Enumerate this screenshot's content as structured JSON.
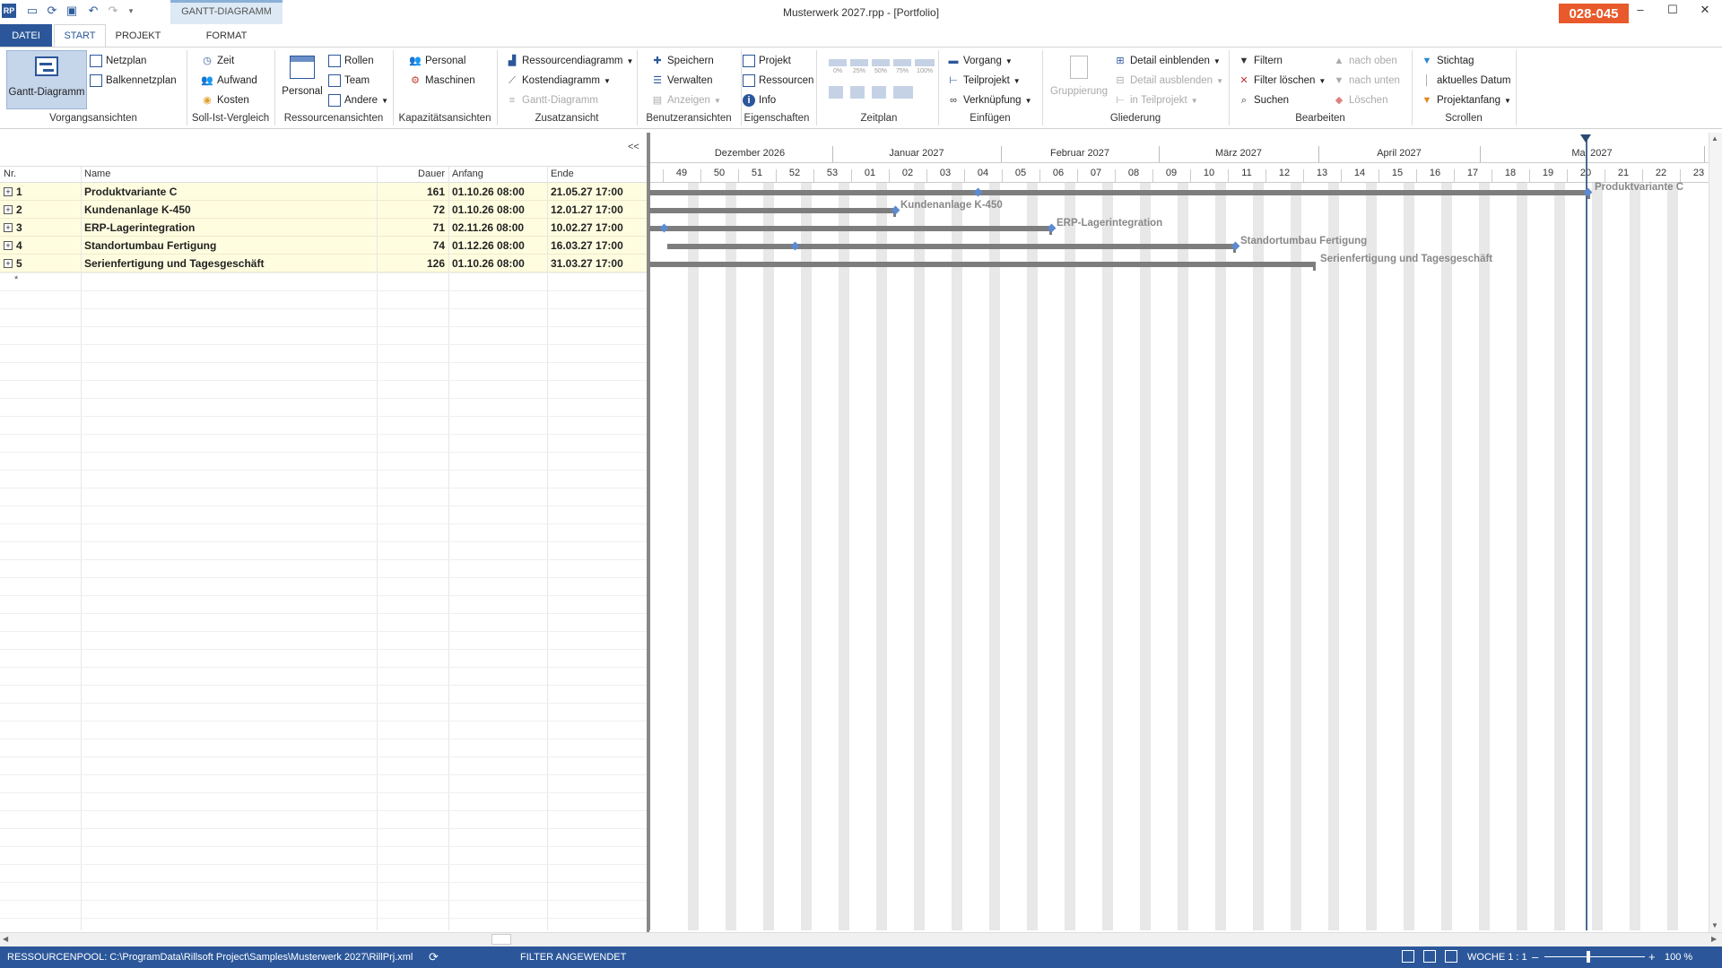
{
  "app": {
    "title": "Musterwerk 2027.rpp - [Portfolio]",
    "license": "028-045",
    "context_tab": "GANTT-DIAGRAMM"
  },
  "tabs": {
    "datei": "DATEI",
    "start": "START",
    "projekt": "PROJEKT",
    "format": "FORMAT"
  },
  "ribbon": {
    "vorgangsansichten": {
      "gantt": "Gantt-Diagramm",
      "netzplan": "Netzplan",
      "balkennetzplan": "Balkennetzplan",
      "label": "Vorgangsansichten"
    },
    "sollist": {
      "zeit": "Zeit",
      "aufwand": "Aufwand",
      "kosten": "Kosten",
      "label": "Soll-Ist-Vergleich"
    },
    "ressourcen": {
      "personal": "Personal",
      "rollen": "Rollen",
      "team": "Team",
      "andere": "Andere",
      "label": "Ressourcenansichten"
    },
    "kapazitaet": {
      "personal": "Personal",
      "maschinen": "Maschinen",
      "label": "Kapazitätsansichten"
    },
    "zusatz": {
      "ressourcendiagramm": "Ressourcendiagramm",
      "kostendiagramm": "Kostendiagramm",
      "gantt": "Gantt-Diagramm",
      "label": "Zusatzansicht"
    },
    "benutzer": {
      "speichern": "Speichern",
      "verwalten": "Verwalten",
      "anzeigen": "Anzeigen",
      "label": "Benutzeransichten"
    },
    "eigenschaften": {
      "projekt": "Projekt",
      "ressourcen": "Ressourcen",
      "info": "Info",
      "label": "Eigenschaften"
    },
    "zeitplan": {
      "label": "Zeitplan",
      "p0": "0%",
      "p25": "25%",
      "p50": "50%",
      "p75": "75%",
      "p100": "100%"
    },
    "einfuegen": {
      "vorgang": "Vorgang",
      "teilprojekt": "Teilprojekt",
      "verknuepfung": "Verknüpfung",
      "label": "Einfügen"
    },
    "gliederung": {
      "gruppierung": "Gruppierung",
      "einblenden": "Detail einblenden",
      "ausblenden": "Detail ausblenden",
      "teilprojekt": "in Teilprojekt",
      "label": "Gliederung"
    },
    "bearbeiten": {
      "filtern": "Filtern",
      "filterloeschen": "Filter löschen",
      "suchen": "Suchen",
      "nachoben": "nach oben",
      "nachunten": "nach unten",
      "loeschen": "Löschen",
      "label": "Bearbeiten"
    },
    "scrollen": {
      "stichtag": "Stichtag",
      "datum": "aktuelles Datum",
      "projektanfang": "Projektanfang",
      "label": "Scrollen"
    }
  },
  "table": {
    "collapse": "<<",
    "headers": {
      "nr": "Nr.",
      "name": "Name",
      "dauer": "Dauer",
      "anfang": "Anfang",
      "ende": "Ende"
    },
    "new_row_marker": "*",
    "rows": [
      {
        "nr": "1",
        "name": "Produktvariante C",
        "dauer": "161",
        "anfang": "01.10.26 08:00",
        "ende": "21.05.27 17:00"
      },
      {
        "nr": "2",
        "name": "Kundenanlage K-450",
        "dauer": "72",
        "anfang": "01.10.26 08:00",
        "ende": "12.01.27 17:00"
      },
      {
        "nr": "3",
        "name": "ERP-Lagerintegration",
        "dauer": "71",
        "anfang": "02.11.26 08:00",
        "ende": "10.02.27 17:00"
      },
      {
        "nr": "4",
        "name": "Standortumbau Fertigung",
        "dauer": "74",
        "anfang": "01.12.26 08:00",
        "ende": "16.03.27 17:00"
      },
      {
        "nr": "5",
        "name": "Serienfertigung und Tagesgeschäft",
        "dauer": "126",
        "anfang": "01.10.26 08:00",
        "ende": "31.03.27 17:00"
      }
    ]
  },
  "gantt": {
    "months": [
      "Dezember 2026",
      "Januar 2027",
      "Februar 2027",
      "März 2027",
      "April 2027",
      "Mai 2027"
    ],
    "weeks": [
      "49",
      "50",
      "51",
      "52",
      "53",
      "01",
      "02",
      "03",
      "04",
      "05",
      "06",
      "07",
      "08",
      "09",
      "10",
      "11",
      "12",
      "13",
      "14",
      "15",
      "16",
      "17",
      "18",
      "19",
      "20",
      "21",
      "22",
      "23"
    ],
    "bar_labels": [
      "Produktvariante C",
      "Kundenanlage K-450",
      "ERP-Lagerintegration",
      "Standortumbau Fertigung",
      "Serienfertigung und Tagesgeschäft"
    ]
  },
  "status": {
    "pool": "RESSOURCENPOOL: C:\\ProgramData\\Rillsoft Project\\Samples\\Musterwerk 2027\\RillPrj.xml",
    "filter": "FILTER ANGEWENDET",
    "woche": "WOCHE 1 : 1",
    "zoom": "100 %"
  },
  "colors": {
    "accent": "#2b579a",
    "license": "#e8592b",
    "row_highlight": "#fffde0"
  }
}
